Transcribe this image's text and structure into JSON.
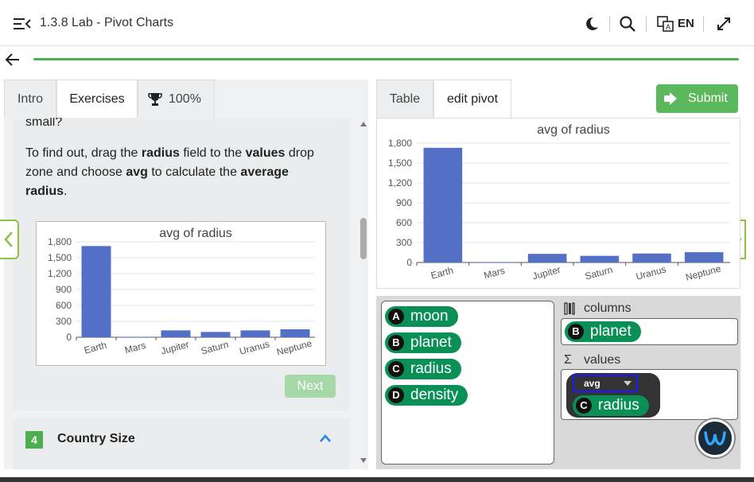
{
  "header": {
    "title": "1.3.8 Lab - Pivot Charts",
    "language": "EN"
  },
  "left_tabs": [
    {
      "label": "Intro"
    },
    {
      "label": "Exercises"
    },
    {
      "label": "100%"
    }
  ],
  "content": {
    "cut_text": "small?",
    "instr_1": "To find out, drag the ",
    "instr_2": "radius",
    "instr_3": " field to the ",
    "instr_4": "values",
    "instr_5": " drop",
    "instr_6": "zone and choose ",
    "instr_7": "avg",
    "instr_8": " to calculate the ",
    "instr_9": "average",
    "instr_10": "radius",
    "instr_11": ".",
    "next_label": "Next",
    "section_number": "4",
    "section_title": "Country Size"
  },
  "right_tabs": [
    {
      "label": "Table"
    },
    {
      "label": "edit pivot"
    }
  ],
  "submit_label": "Submit",
  "chart_data": [
    {
      "type": "bar",
      "title": "avg of radius",
      "categories": [
        "Earth",
        "Mars",
        "Jupiter",
        "Saturn",
        "Uranus",
        "Neptune"
      ],
      "values": [
        1720,
        3,
        130,
        100,
        130,
        150
      ],
      "ylim": [
        0,
        1800
      ],
      "yticks": [
        "0",
        "300",
        "600",
        "900",
        "1,200",
        "1,500",
        "1,800"
      ],
      "color": "#5470c6"
    },
    {
      "type": "bar",
      "title": "avg of radius",
      "categories": [
        "Earth",
        "Mars",
        "Jupiter",
        "Saturn",
        "Uranus",
        "Neptune"
      ],
      "values": [
        1730,
        3,
        130,
        100,
        135,
        155
      ],
      "ylim": [
        0,
        1800
      ],
      "yticks": [
        "0",
        "300",
        "600",
        "900",
        "1,200",
        "1,500",
        "1,800"
      ],
      "color": "#5470c6"
    }
  ],
  "pivot": {
    "fields": [
      {
        "badge": "A",
        "name": "moon"
      },
      {
        "badge": "B",
        "name": "planet"
      },
      {
        "badge": "C",
        "name": "radius"
      },
      {
        "badge": "D",
        "name": "density"
      }
    ],
    "columns_label": "columns",
    "values_label": "values",
    "columns_field": {
      "badge": "B",
      "name": "planet"
    },
    "values_field": {
      "badge": "C",
      "name": "radius",
      "agg": "avg"
    }
  }
}
